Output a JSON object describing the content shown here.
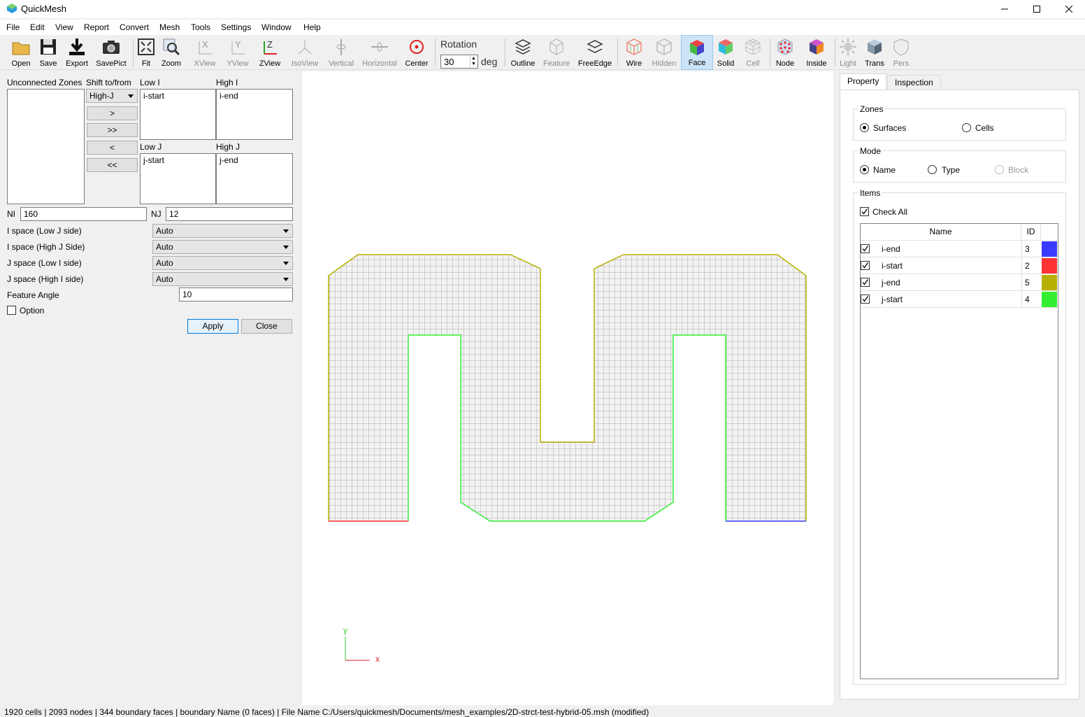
{
  "window": {
    "title": "QuickMesh"
  },
  "menu": [
    "File",
    "Edit",
    "View",
    "Report",
    "Convert",
    "Mesh",
    "Tools",
    "Settings",
    "Window",
    "Help"
  ],
  "toolbar": {
    "open": "Open",
    "save": "Save",
    "export": "Export",
    "savepict": "SavePict",
    "fit": "Fit",
    "zoom": "Zoom",
    "xview": "XView",
    "yview": "YView",
    "zview": "ZView",
    "isoview": "IsoView",
    "vertical": "Vertical",
    "horizontal": "Horizontal",
    "center": "Center",
    "rotation_label": "Rotation",
    "rotation_value": "30",
    "rotation_unit": "deg",
    "outline": "Outline",
    "feature": "Feature",
    "freeedge": "FreeEdge",
    "wire": "Wire",
    "hidden": "Hidden",
    "face": "Face",
    "solid": "Solid",
    "cell": "Cell",
    "node": "Node",
    "inside": "Inside",
    "light": "Light",
    "trans": "Trans",
    "pers": "Pers"
  },
  "left": {
    "unconnected_label": "Unconnected Zones",
    "shift_label": "Shift to/from",
    "shift_value": "High-J",
    "btn_right": ">",
    "btn_right_all": ">>",
    "btn_left": "<",
    "btn_left_all": "<<",
    "low_i_label": "Low I",
    "low_i_value": "i-start",
    "high_i_label": "High I",
    "high_i_value": "i-end",
    "low_j_label": "Low J",
    "low_j_value": "j-start",
    "high_j_label": "High J",
    "high_j_value": "j-end",
    "ni_label": "NI",
    "ni_value": "160",
    "nj_label": "NJ",
    "nj_value": "12",
    "ispace_low_label": "I space (Low J side)",
    "ispace_low_value": "Auto",
    "ispace_high_label": "I space (High J Side)",
    "ispace_high_value": "Auto",
    "jspace_low_label": "J space (Low I side)",
    "jspace_low_value": "Auto",
    "jspace_high_label": "J space (High I side)",
    "jspace_high_value": "Auto",
    "feature_angle_label": "Feature Angle",
    "feature_angle_value": "10",
    "option_label": "Option",
    "apply": "Apply",
    "close": "Close"
  },
  "viewport": {
    "axis_y": "y",
    "axis_x": "x"
  },
  "right": {
    "tab_property": "Property",
    "tab_inspection": "Inspection",
    "zones_title": "Zones",
    "zones_surfaces": "Surfaces",
    "zones_cells": "Cells",
    "mode_title": "Mode",
    "mode_name": "Name",
    "mode_type": "Type",
    "mode_block": "Block",
    "items_title": "Items",
    "check_all": "Check All",
    "col_name": "Name",
    "col_id": "ID",
    "items": [
      {
        "name": "i-end",
        "id": "3",
        "color": "#3b3bff"
      },
      {
        "name": "i-start",
        "id": "2",
        "color": "#ff3333"
      },
      {
        "name": "j-end",
        "id": "5",
        "color": "#b8b000"
      },
      {
        "name": "j-start",
        "id": "4",
        "color": "#33ee33"
      }
    ]
  },
  "status": "1920 cells | 2093 nodes | 344 boundary faces |  boundary Name  (0 faces) | File Name C:/Users/quickmesh/Documents/mesh_examples/2D-strct-test-hybrid-05.msh (modified)"
}
